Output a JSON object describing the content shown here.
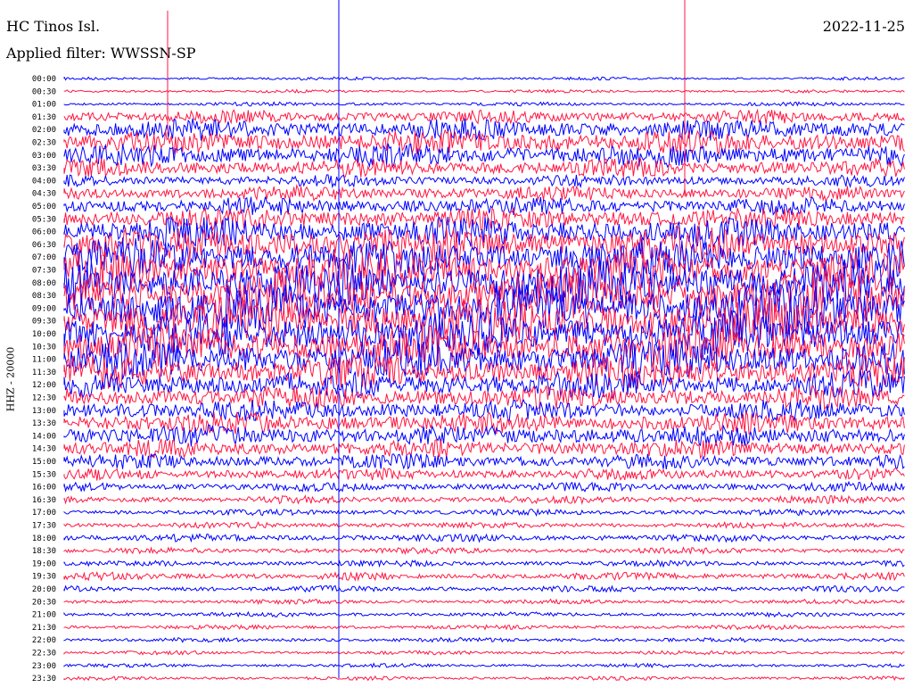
{
  "header": {
    "station": "HC Tinos Isl.",
    "date": "2022-11-25",
    "filter_text": "Applied filter: WWSSN-SP"
  },
  "channel_label": "HHZ - 20000",
  "colors": {
    "trace_a": "#0000ff",
    "trace_b": "#ff1744",
    "background": "#ffffff"
  },
  "chart_data": {
    "type": "line",
    "title": "HC Tinos Isl.",
    "subtitle": "Applied filter: WWSSN-SP",
    "ylabel": "HHZ - 20000",
    "xlabel": "",
    "grid": false,
    "legend": "none",
    "categories": [
      "00:00",
      "00:30",
      "01:00",
      "01:30",
      "02:00",
      "02:30",
      "03:00",
      "03:30",
      "04:00",
      "04:30",
      "05:00",
      "05:30",
      "06:00",
      "06:30",
      "07:00",
      "07:30",
      "08:00",
      "08:30",
      "09:00",
      "09:30",
      "10:00",
      "10:30",
      "11:00",
      "11:30",
      "12:00",
      "12:30",
      "13:00",
      "13:30",
      "14:00",
      "14:30",
      "15:00",
      "15:30",
      "16:00",
      "16:30",
      "17:00",
      "17:30",
      "18:00",
      "18:30",
      "19:00",
      "19:30",
      "20:00",
      "20:30",
      "21:00",
      "21:30",
      "22:00",
      "22:30",
      "23:00",
      "23:30"
    ],
    "relative_amplitude": [
      0.2,
      0.2,
      0.25,
      0.9,
      1.4,
      1.6,
      1.5,
      1.2,
      0.8,
      1.0,
      1.2,
      1.5,
      2.0,
      2.4,
      2.6,
      2.8,
      3.0,
      3.2,
      3.2,
      3.0,
      3.0,
      2.8,
      2.6,
      2.2,
      1.8,
      1.5,
      1.4,
      1.4,
      1.4,
      1.2,
      1.0,
      0.8,
      0.6,
      0.5,
      0.4,
      0.4,
      0.5,
      0.4,
      0.4,
      0.5,
      0.4,
      0.3,
      0.3,
      0.3,
      0.3,
      0.25,
      0.25,
      0.25
    ]
  }
}
